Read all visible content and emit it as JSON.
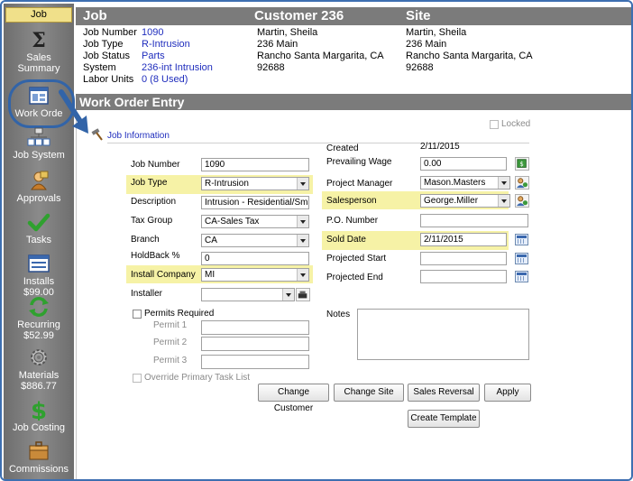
{
  "sidebar": {
    "header": "Job",
    "items": [
      {
        "label": "Sales\nSummary",
        "line1": "Sales",
        "line2": "Summary",
        "icon": "sigma-icon"
      },
      {
        "label": "Work Orde",
        "line1": "Work Orde",
        "line2": "",
        "icon": "work-order-icon"
      },
      {
        "label": "Job System",
        "line1": "Job System",
        "line2": "",
        "icon": "job-system-icon"
      },
      {
        "label": "Approvals",
        "line1": "Approvals",
        "line2": "",
        "icon": "approvals-icon"
      },
      {
        "label": "Tasks",
        "line1": "Tasks",
        "line2": "",
        "icon": "checkmark-icon"
      },
      {
        "label": "Installs",
        "line1": "Installs",
        "line2": "$99.00",
        "icon": "installs-icon"
      },
      {
        "label": "Recurring",
        "line1": "Recurring",
        "line2": "$52.99",
        "icon": "recurring-icon"
      },
      {
        "label": "Materials",
        "line1": "Materials",
        "line2": "$886.77",
        "icon": "gear-icon"
      },
      {
        "label": "Job Costing",
        "line1": "Job Costing",
        "line2": "",
        "icon": "dollar-icon"
      },
      {
        "label": "Commissions",
        "line1": "Commissions",
        "line2": "",
        "icon": "commissions-icon"
      }
    ]
  },
  "header": {
    "job_title": "Job",
    "customer_title": "Customer 236",
    "site_title": "Site",
    "job_fields": [
      {
        "label": "Job Number",
        "value": "1090"
      },
      {
        "label": "Job Type",
        "value": "R-Intrusion"
      },
      {
        "label": "Job Status",
        "value": "Parts"
      },
      {
        "label": "System",
        "value": "236-int Intrusion"
      },
      {
        "label": "Labor Units",
        "value": "0 (8 Used)"
      }
    ],
    "customer_lines": [
      "Martin, Sheila",
      "236 Main",
      "Rancho Santa Margarita, CA",
      "92688"
    ],
    "site_lines": [
      "Martin, Sheila",
      "236 Main",
      "Rancho Santa Margarita, CA",
      "92688"
    ]
  },
  "work_order": {
    "title": "Work Order Entry",
    "section_label": "Job Information",
    "locked_label": "Locked",
    "left_fields": {
      "job_number": {
        "label": "Job Number",
        "value": "1090"
      },
      "job_type": {
        "label": "Job Type",
        "value": "R-Intrusion"
      },
      "description": {
        "label": "Description",
        "value": "Intrusion - Residential/Small Co"
      },
      "tax_group": {
        "label": "Tax Group",
        "value": "CA-Sales Tax"
      },
      "branch": {
        "label": "Branch",
        "value": "CA"
      },
      "holdback": {
        "label": "HoldBack  %",
        "value": "0"
      },
      "install_company": {
        "label": "Install Company",
        "value": "MI"
      },
      "installer": {
        "label": "Installer",
        "value": ""
      }
    },
    "permits_required_label": "Permits Required",
    "permits": [
      {
        "label": "Permit 1",
        "value": ""
      },
      {
        "label": "Permit 2",
        "value": ""
      },
      {
        "label": "Permit 3",
        "value": ""
      }
    ],
    "override_label": "Override Primary Task List",
    "right_fields": {
      "created": {
        "label": "Created",
        "value": "2/11/2015"
      },
      "prevailing_wage": {
        "label": "Prevailing Wage",
        "value": "0.00"
      },
      "project_manager": {
        "label": "Project Manager",
        "value": "Mason.Masters"
      },
      "salesperson": {
        "label": "Salesperson",
        "value": "George.Miller"
      },
      "po_number": {
        "label": "P.O. Number",
        "value": ""
      },
      "sold_date": {
        "label": "Sold Date",
        "value": "2/11/2015"
      },
      "projected_start": {
        "label": "Projected Start",
        "value": ""
      },
      "projected_end": {
        "label": "Projected End",
        "value": ""
      }
    },
    "notes_label": "Notes",
    "buttons": {
      "change_customer": "Change Customer",
      "change_site": "Change Site",
      "sales_reversal": "Sales Reversal",
      "apply": "Apply",
      "create_template": "Create Template"
    }
  },
  "colors": {
    "highlight": "#f6f2a6",
    "header_bar": "#7b7b7b",
    "link_blue": "#1f2dbd",
    "accent_border": "#3d6fb1"
  }
}
